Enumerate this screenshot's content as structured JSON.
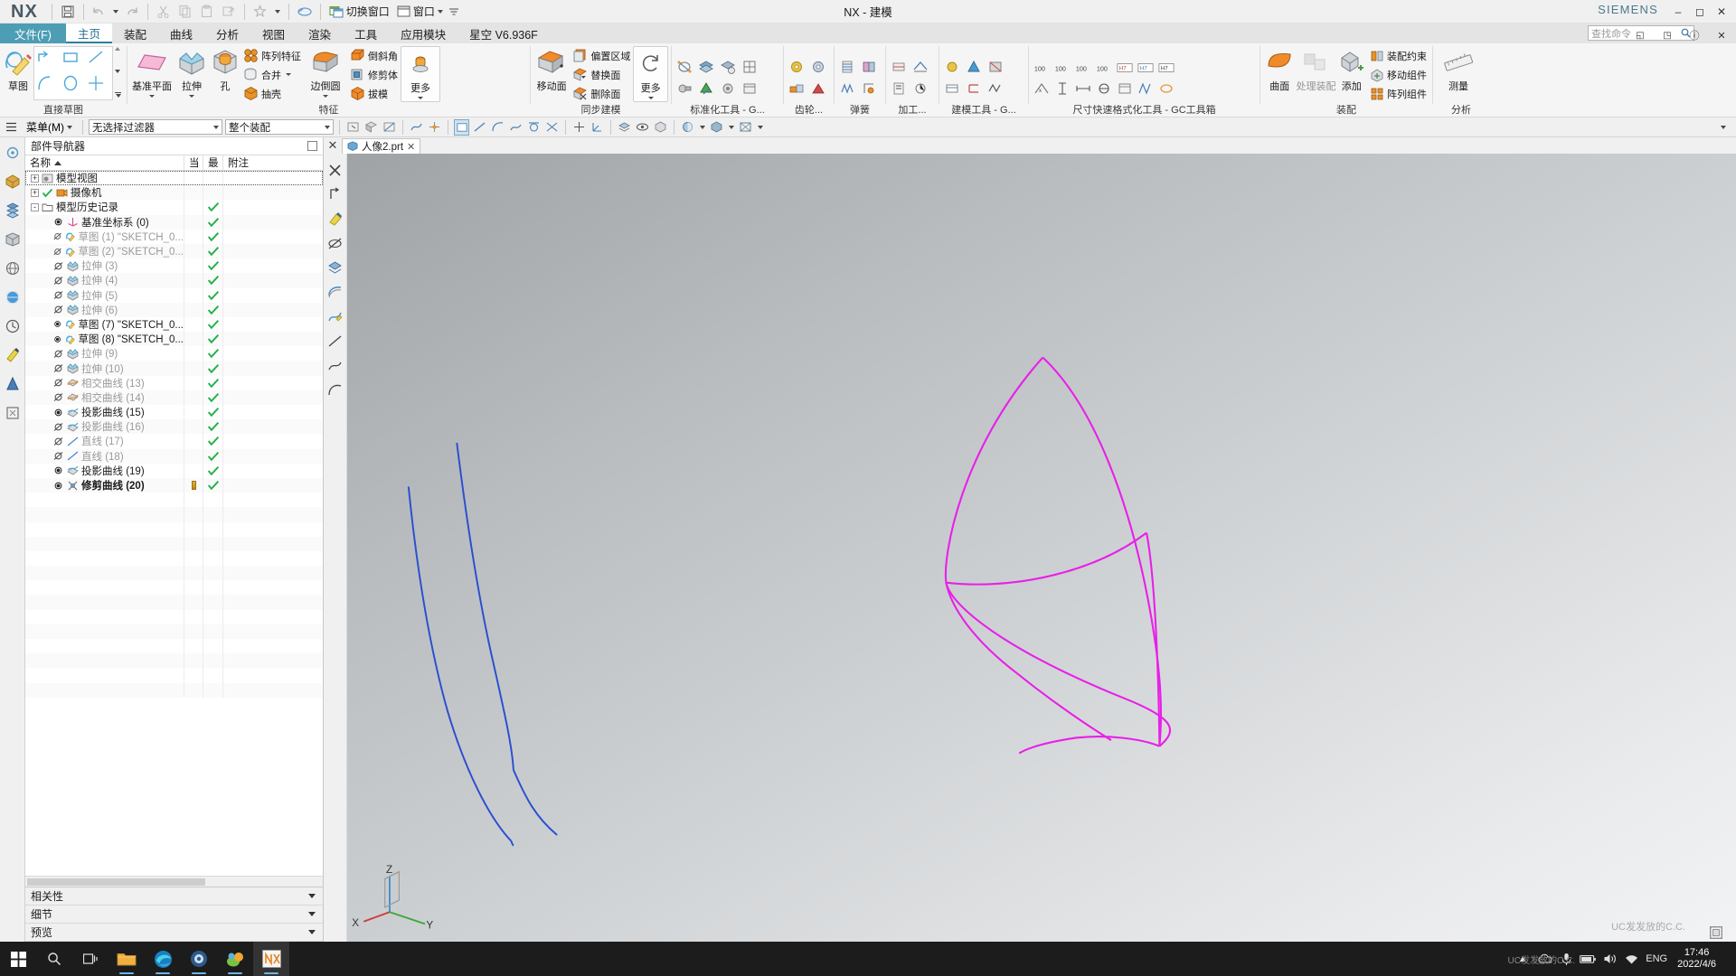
{
  "window": {
    "title": "NX - 建模",
    "logo": "NX",
    "brand": "SIEMENS",
    "controls": [
      "minimize",
      "maximize",
      "close"
    ]
  },
  "quick_access": {
    "items": [
      {
        "name": "save",
        "icon": "floppy-disk-icon",
        "label": ""
      },
      {
        "name": "undo",
        "icon": "undo-arrow-icon",
        "label": ""
      },
      {
        "name": "undo-dropdown",
        "icon": "chevron-down-icon",
        "label": ""
      },
      {
        "name": "redo",
        "icon": "redo-arrow-icon",
        "label": ""
      },
      {
        "name": "cut",
        "icon": "scissors-icon",
        "label": ""
      },
      {
        "name": "copy",
        "icon": "copy-icon",
        "label": ""
      },
      {
        "name": "paste",
        "icon": "clipboard-icon",
        "label": ""
      },
      {
        "name": "paste-special",
        "icon": "paste-special-icon",
        "label": ""
      },
      {
        "name": "favorites",
        "icon": "star-icon",
        "label": ""
      },
      {
        "name": "favorites-dropdown",
        "icon": "chevron-down-icon",
        "label": ""
      },
      {
        "name": "undo-history",
        "icon": "eraser-icon",
        "label": ""
      }
    ],
    "switch_window_label": "切换窗口",
    "window_label": "窗口",
    "more_label": ""
  },
  "ribbon_tabs": [
    {
      "id": "file",
      "label": "文件(F)",
      "style": "file"
    },
    {
      "id": "home",
      "label": "主页",
      "style": "active"
    },
    {
      "id": "assembly",
      "label": "装配",
      "style": ""
    },
    {
      "id": "curve",
      "label": "曲线",
      "style": ""
    },
    {
      "id": "analysis",
      "label": "分析",
      "style": ""
    },
    {
      "id": "view",
      "label": "视图",
      "style": ""
    },
    {
      "id": "render",
      "label": "渲染",
      "style": ""
    },
    {
      "id": "tools",
      "label": "工具",
      "style": ""
    },
    {
      "id": "appmodule",
      "label": "应用模块",
      "style": ""
    },
    {
      "id": "starsky",
      "label": "星空 V6.936F",
      "style": ""
    }
  ],
  "command_search": {
    "placeholder": "查找命令",
    "icon": "search-icon"
  },
  "ribbon_groups": [
    {
      "name": "direct-sketch",
      "label": "直接草图",
      "big_buttons": [
        {
          "label": "草图",
          "icon": "sketch-icon"
        }
      ],
      "sketch_tools": [
        "profile-icon",
        "rectangle-icon",
        "line-icon",
        "arc-icon",
        "circle-icon",
        "dimension-icon"
      ]
    },
    {
      "name": "feature",
      "label": "特征",
      "big_buttons": [
        {
          "label": "基准平面",
          "icon": "datum-plane-icon",
          "dropdown": true
        },
        {
          "label": "拉伸",
          "icon": "extrude-icon",
          "dropdown": true
        },
        {
          "label": "孔",
          "icon": "hole-icon"
        },
        {
          "label": "边倒圆",
          "icon": "edge-blend-icon",
          "dropdown": true
        },
        {
          "label": "更多",
          "icon": "more-feature-icon",
          "dropdown": true
        }
      ],
      "small_buttons": [
        {
          "label": "阵列特征",
          "icon": "pattern-feature-icon"
        },
        {
          "label": "合并",
          "icon": "unite-icon",
          "dropdown": true
        },
        {
          "label": "抽壳",
          "icon": "shell-icon"
        },
        {
          "label": "倒斜角",
          "icon": "chamfer-icon"
        },
        {
          "label": "修剪体",
          "icon": "trim-body-icon"
        },
        {
          "label": "拔模",
          "icon": "draft-icon"
        }
      ]
    },
    {
      "name": "synchronous-modeling",
      "label": "同步建模",
      "big_buttons": [
        {
          "label": "移动面",
          "icon": "move-face-icon"
        },
        {
          "label": "更多",
          "icon": "more-sync-icon",
          "dropdown": true
        }
      ],
      "small_buttons": [
        {
          "label": "偏置区域",
          "icon": "offset-region-icon"
        },
        {
          "label": "替换面",
          "icon": "replace-face-icon"
        },
        {
          "label": "删除面",
          "icon": "delete-face-icon"
        }
      ]
    },
    {
      "name": "standardize-tools",
      "label": "标准化工具 - G...",
      "icon_count": 8
    },
    {
      "name": "gear",
      "label": "齿轮...",
      "icon_count": 3
    },
    {
      "name": "spring",
      "label": "弹簧",
      "icon_count": 2,
      "dropdown": true
    },
    {
      "name": "machining",
      "label": "加工...",
      "icon_count": 2,
      "dropdown": true
    },
    {
      "name": "modeling-tools",
      "label": "建模工具 - G...",
      "icon_count": 4,
      "dropdown": true
    },
    {
      "name": "dim-format-tools",
      "label": "尺寸快速格式化工具 - GC工具箱",
      "icon_count": 12
    },
    {
      "name": "assembly-group",
      "label": "装配",
      "big_buttons": [
        {
          "label": "曲面",
          "icon": "surface-icon"
        },
        {
          "label": "处理装配",
          "icon": "process-assembly-icon"
        },
        {
          "label": "添加",
          "icon": "add-component-icon"
        }
      ],
      "small_buttons": [
        {
          "label": "装配约束",
          "icon": "assembly-constraint-icon"
        },
        {
          "label": "移动组件",
          "icon": "move-component-icon"
        },
        {
          "label": "阵列组件",
          "icon": "pattern-component-icon"
        }
      ]
    },
    {
      "name": "analysis-group",
      "label": "分析",
      "big_buttons": [
        {
          "label": "测量",
          "icon": "measure-icon"
        }
      ]
    }
  ],
  "selection_bar": {
    "menu_label": "菜单(M)",
    "filter_value": "无选择过滤器",
    "scope_value": "整个装配",
    "icons": [
      "select-object-icon",
      "face-icon",
      "edge-icon",
      "curve-icon",
      "point-icon",
      "snap-icon",
      "layer-icon",
      "wcs-icon",
      "render-style-icon",
      "shaded-icon",
      "wireframe-icon"
    ]
  },
  "navigator": {
    "title": "部件导航器",
    "pin_icon": "pin-icon",
    "columns": [
      "名称",
      "当",
      "最",
      "附注"
    ],
    "sort_column": "名称",
    "rows": [
      {
        "label": "模型视图",
        "indent": 0,
        "expander": "+",
        "icon": "model-view-icon",
        "vis": "",
        "check": "",
        "dim": false,
        "selected": true
      },
      {
        "label": "摄像机",
        "indent": 0,
        "expander": "+",
        "icon": "camera-icon",
        "vis": "check",
        "check": "",
        "dim": false
      },
      {
        "label": "模型历史记录",
        "indent": 0,
        "expander": "-",
        "icon": "folder-icon",
        "vis": "",
        "check": "yes",
        "dim": false
      },
      {
        "label": "基准坐标系 (0)",
        "indent": 1,
        "expander": "",
        "icon": "datum-csys-icon",
        "vis": "eye",
        "check": "yes",
        "dim": false
      },
      {
        "label": "草图 (1) \"SKETCH_0...",
        "indent": 1,
        "expander": "",
        "icon": "sketch-item-icon",
        "vis": "eye-off",
        "check": "yes",
        "dim": true
      },
      {
        "label": "草图 (2) \"SKETCH_0...",
        "indent": 1,
        "expander": "",
        "icon": "sketch-item-icon",
        "vis": "eye-off",
        "check": "yes",
        "dim": true
      },
      {
        "label": "拉伸 (3)",
        "indent": 1,
        "expander": "",
        "icon": "extrude-item-icon",
        "vis": "eye-off",
        "check": "yes",
        "dim": true
      },
      {
        "label": "拉伸 (4)",
        "indent": 1,
        "expander": "",
        "icon": "extrude-item-icon",
        "vis": "eye-off",
        "check": "yes",
        "dim": true
      },
      {
        "label": "拉伸 (5)",
        "indent": 1,
        "expander": "",
        "icon": "extrude-item-icon",
        "vis": "eye-off",
        "check": "yes",
        "dim": true
      },
      {
        "label": "拉伸 (6)",
        "indent": 1,
        "expander": "",
        "icon": "extrude-item-icon",
        "vis": "eye-off",
        "check": "yes",
        "dim": true
      },
      {
        "label": "草图 (7) \"SKETCH_0...",
        "indent": 1,
        "expander": "",
        "icon": "sketch-item-icon",
        "vis": "eye",
        "check": "yes",
        "dim": false
      },
      {
        "label": "草图 (8) \"SKETCH_0...",
        "indent": 1,
        "expander": "",
        "icon": "sketch-item-icon",
        "vis": "eye",
        "check": "yes",
        "dim": false
      },
      {
        "label": "拉伸 (9)",
        "indent": 1,
        "expander": "",
        "icon": "extrude-item-icon",
        "vis": "eye-off",
        "check": "yes",
        "dim": true
      },
      {
        "label": "拉伸 (10)",
        "indent": 1,
        "expander": "",
        "icon": "extrude-item-icon",
        "vis": "eye-off",
        "check": "yes",
        "dim": true
      },
      {
        "label": "相交曲线 (13)",
        "indent": 1,
        "expander": "",
        "icon": "intersect-curve-icon",
        "vis": "eye-off",
        "check": "yes",
        "dim": true
      },
      {
        "label": "相交曲线 (14)",
        "indent": 1,
        "expander": "",
        "icon": "intersect-curve-icon",
        "vis": "eye-off",
        "check": "yes",
        "dim": true
      },
      {
        "label": "投影曲线 (15)",
        "indent": 1,
        "expander": "",
        "icon": "project-curve-icon",
        "vis": "eye",
        "check": "yes",
        "dim": false
      },
      {
        "label": "投影曲线 (16)",
        "indent": 1,
        "expander": "",
        "icon": "project-curve-icon",
        "vis": "eye-off",
        "check": "yes",
        "dim": true
      },
      {
        "label": "直线 (17)",
        "indent": 1,
        "expander": "",
        "icon": "line-item-icon",
        "vis": "eye-off",
        "check": "yes",
        "dim": true
      },
      {
        "label": "直线 (18)",
        "indent": 1,
        "expander": "",
        "icon": "line-item-icon",
        "vis": "eye-off",
        "check": "yes",
        "dim": true
      },
      {
        "label": "投影曲线 (19)",
        "indent": 1,
        "expander": "",
        "icon": "project-curve-icon",
        "vis": "eye",
        "check": "yes",
        "dim": false
      },
      {
        "label": "修剪曲线 (20)",
        "indent": 1,
        "expander": "",
        "icon": "trim-curve-icon",
        "vis": "eye",
        "check": "yes",
        "dim": false,
        "bold": true,
        "marker": true
      }
    ],
    "sections": [
      {
        "label": "相关性",
        "state": "collapsed"
      },
      {
        "label": "细节",
        "state": "collapsed"
      },
      {
        "label": "预览",
        "state": "collapsed"
      }
    ]
  },
  "document_tab": {
    "label": "人像2.prt",
    "icon": "part-file-icon",
    "close_icon": "close-icon"
  },
  "view_tools": [
    {
      "name": "close-view",
      "icon": "close-icon"
    },
    {
      "name": "orient-view",
      "icon": "orient-view-icon"
    },
    {
      "name": "render-style",
      "icon": "render-style-icon"
    },
    {
      "name": "hide",
      "icon": "hide-icon"
    },
    {
      "name": "layers",
      "icon": "layers-icon"
    },
    {
      "name": "highlight-edge",
      "icon": "highlight-edge-icon"
    },
    {
      "name": "sketch-curve",
      "icon": "sketch-curve-icon"
    },
    {
      "name": "line-tool",
      "icon": "line-tool-icon"
    },
    {
      "name": "curve-tool",
      "icon": "curve-tool-icon"
    },
    {
      "name": "arc-tool",
      "icon": "arc-tool-icon"
    }
  ],
  "canvas": {
    "blue_curve_color": "#2a4fd0",
    "magenta_curve_color": "#e820e8",
    "triad_labels": {
      "z": "Z",
      "y": "Y",
      "x": "X"
    },
    "watermark": "UC发发放的C.C."
  },
  "taskbar": {
    "start_icon": "windows-start-icon",
    "search_icon": "search-icon",
    "taskview_icon": "task-view-icon",
    "apps": [
      {
        "name": "file-explorer",
        "icon": "folder-icon",
        "running": true
      },
      {
        "name": "edge-browser",
        "icon": "edge-icon",
        "running": true
      },
      {
        "name": "app-blue-circle",
        "icon": "circle-app-icon",
        "running": true
      },
      {
        "name": "app-green",
        "icon": "green-app-icon",
        "running": true
      },
      {
        "name": "nx-app",
        "icon": "nx-icon",
        "running": true,
        "active": true
      }
    ],
    "tray": {
      "chevron": "chevron-up-icon",
      "icons": [
        "onedrive-icon",
        "microphone-icon",
        "battery-icon",
        "volume-icon",
        "network-icon"
      ],
      "ime": "ENG",
      "time": "17:46",
      "date": "2022/4/6",
      "watermark": "UC发发放的C.C."
    }
  }
}
